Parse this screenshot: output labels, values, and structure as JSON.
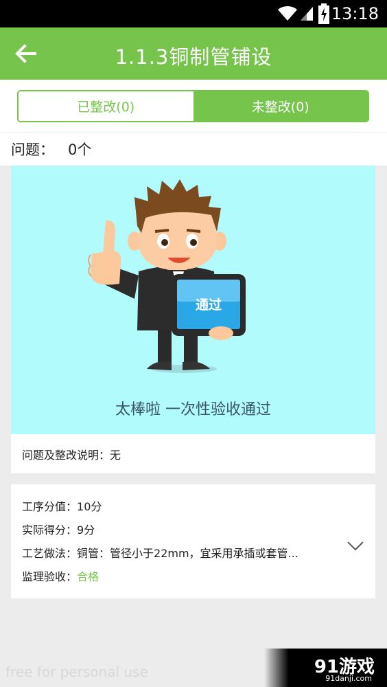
{
  "status_bar": {
    "time": "13:18"
  },
  "app_bar": {
    "title": "1.1.3铜制管铺设",
    "back_icon": "arrow-left-icon"
  },
  "tabs": [
    {
      "label": "已整改(0)",
      "selected": false
    },
    {
      "label": "未整改(0)",
      "selected": true
    }
  ],
  "issues": {
    "label": "问题：",
    "count": "0个"
  },
  "pass_card": {
    "badge": "通过",
    "message": "太棒啦   一次性验收通过"
  },
  "explanation": {
    "label": "问题及整改说明：",
    "value": "无"
  },
  "details": {
    "score_label": "工序分值：",
    "score_value": "10分",
    "actual_label": "实际得分：",
    "actual_value": "9分",
    "method_label": "工艺做法：",
    "method_value": "铜管：管径小于22mm，宜采用承插或套管...",
    "supervision_label": "监理验收：",
    "supervision_value": "合格"
  },
  "watermark": {
    "text": "free for personal use",
    "brand": "91游戏",
    "site": "91danji.com"
  },
  "colors": {
    "accent": "#76c44b",
    "card_bg": "#b2fbfd",
    "page_bg": "#ececec"
  }
}
